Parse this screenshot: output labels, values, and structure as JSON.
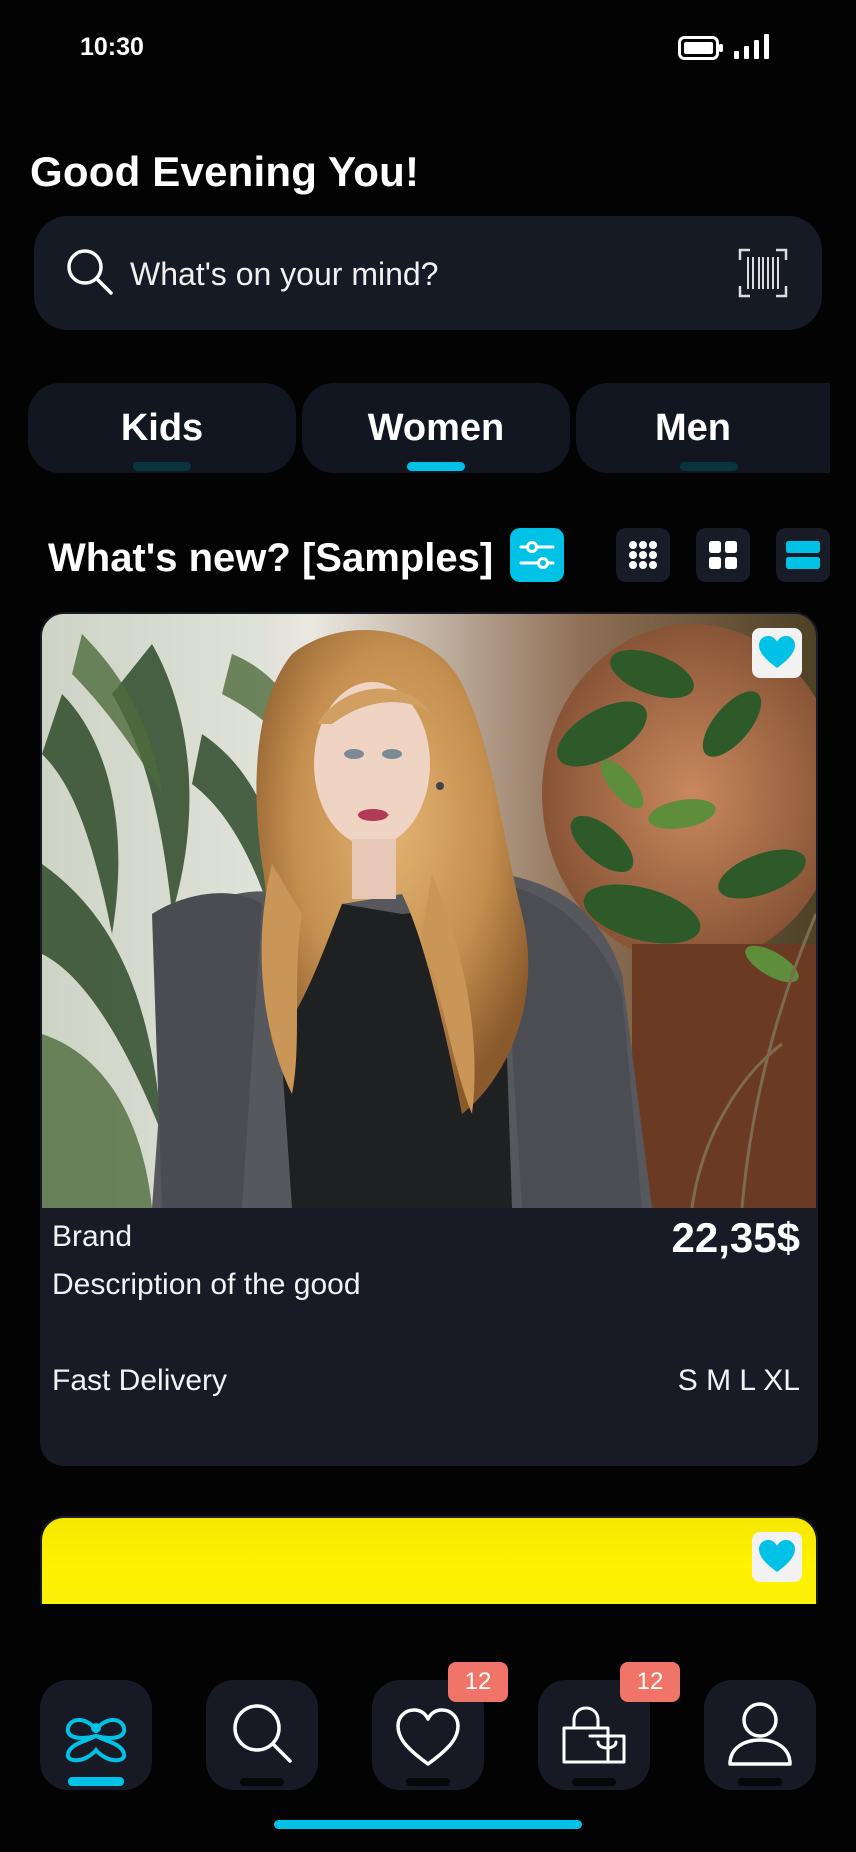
{
  "status_bar": {
    "time": "10:30",
    "icons": [
      "battery-icon",
      "signal-icon"
    ]
  },
  "header": {
    "greeting": "Good Evening You!"
  },
  "search": {
    "placeholder": "What's on your mind?",
    "icons": [
      "search-icon",
      "barcode-icon"
    ]
  },
  "categories": [
    {
      "label": "Kids",
      "active": false
    },
    {
      "label": "Women",
      "active": true
    },
    {
      "label": "Men",
      "active": false
    }
  ],
  "section": {
    "title": "What's new? [Samples]",
    "controls": [
      "filter-icon",
      "grid-3x3-icon",
      "grid-2x2-icon",
      "list-view-icon"
    ],
    "active_view": "list-view"
  },
  "products": [
    {
      "brand": "Brand",
      "description": "Description of the good",
      "price": "22,35$",
      "delivery": "Fast Delivery",
      "sizes": "S M L XL",
      "favorited": true
    },
    {
      "favorited": true
    }
  ],
  "bottom_nav": {
    "items": [
      "home-logo-icon",
      "search-icon",
      "heart-icon",
      "shopping-bag-icon",
      "profile-icon"
    ],
    "active": "home",
    "favorites_badge": "12",
    "cart_badge": "12"
  },
  "colors": {
    "accent": "#00c2e6",
    "background": "#030303",
    "surface": "#181b26",
    "badge": "#f07468"
  }
}
